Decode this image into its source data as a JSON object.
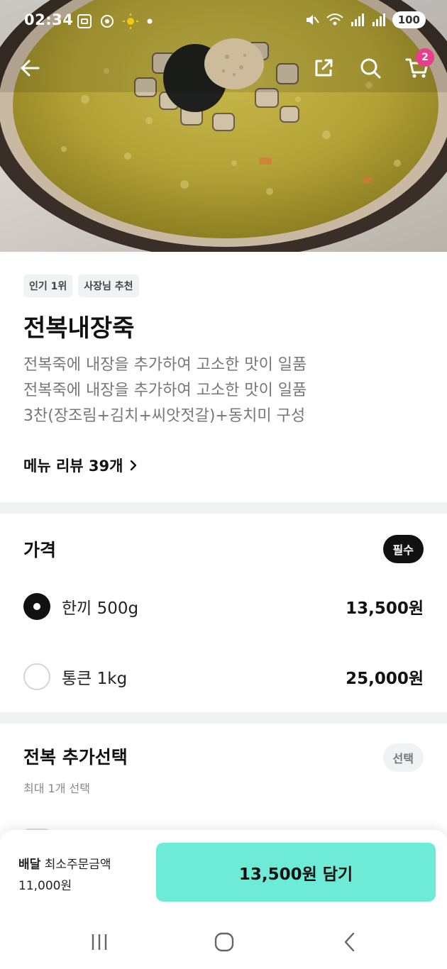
{
  "status_bar": {
    "time": "02:34",
    "battery": "100"
  },
  "nav": {
    "cart_count": "2"
  },
  "menu": {
    "tags": [
      "인기 1위",
      "사장님 추천"
    ],
    "title": "전복내장죽",
    "description_lines": [
      "전복죽에 내장을 추가하여 고소한 맛이 일품",
      "전복죽에 내장을 추가하여 고소한 맛이 일품",
      "3찬(장조림+김치+씨앗젓갈)+동치미 구성"
    ],
    "review_link": "메뉴 리뷰 39개"
  },
  "price_section": {
    "title": "가격",
    "badge": "필수",
    "options": [
      {
        "label": "한끼 500g",
        "price": "13,500원",
        "selected": true
      },
      {
        "label": "통큰 1kg",
        "price": "25,000원",
        "selected": false
      }
    ]
  },
  "extra_section": {
    "title": "전복 추가선택",
    "badge": "선택",
    "subtitle": "최대 1개 선택"
  },
  "bottom_bar": {
    "delivery_label": "배달",
    "min_order_label": "최소주문금액",
    "min_order_value": "11,000원",
    "cta_label": "13,500원 담기"
  },
  "colors": {
    "cta_bg": "#6eebd6",
    "cart_badge": "#e83e8c",
    "porridge": "#b9a93a"
  }
}
